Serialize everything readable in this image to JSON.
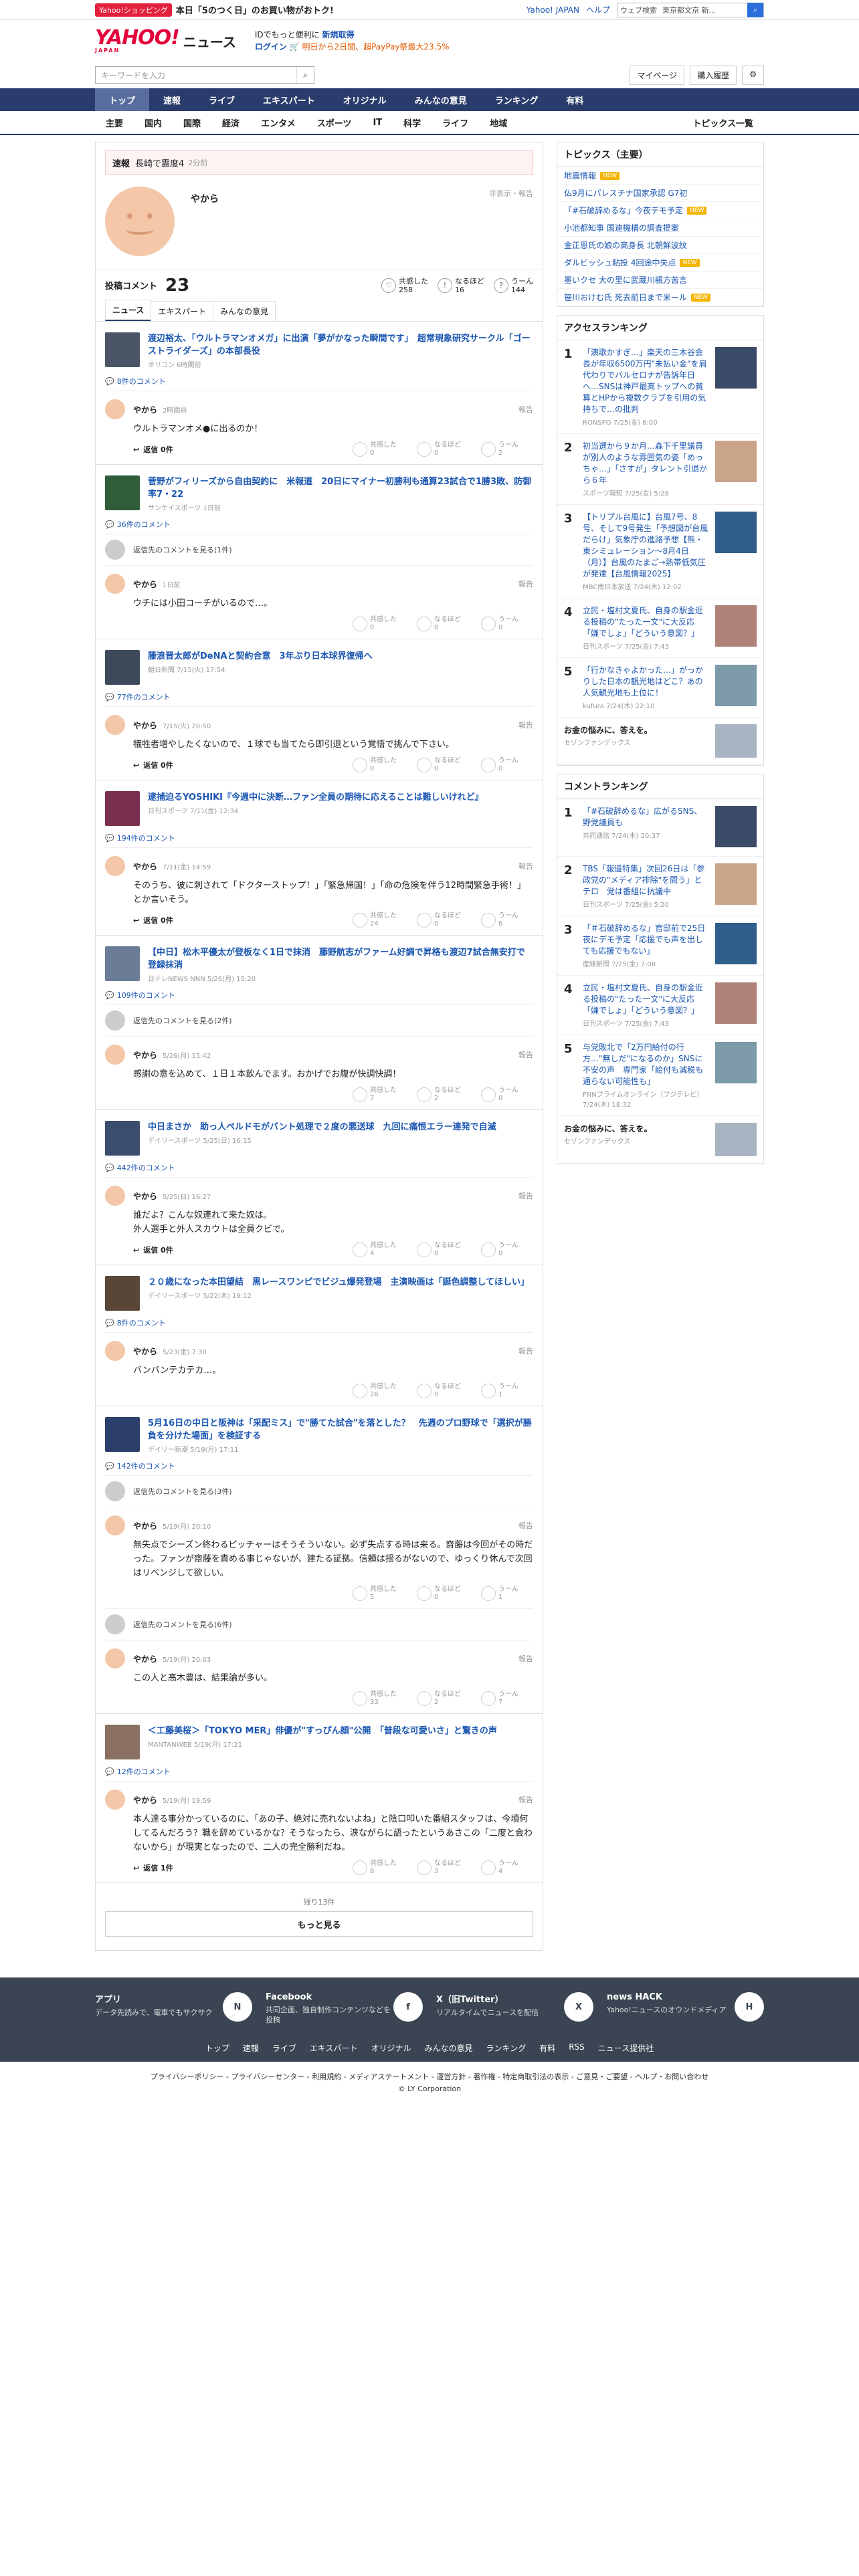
{
  "topbar": {
    "badge": "Yahoo!ショッピング",
    "promo": "本日「5のつく日」のお買い物がおトク!",
    "links": [
      "Yahoo! JAPAN",
      "ヘルプ"
    ],
    "search_placeholder": "ウェブ検索",
    "search_query": "東京都文京 新..."
  },
  "header": {
    "logo": "YAHOO!",
    "logo_sub": "JAPAN",
    "service": "ニュース",
    "line1a": "IDでもっと便利に",
    "line1b": "新規取得",
    "line2a": "ログイン",
    "line2b": "🛒 明日から2日間、超PayPay祭最大23.5%"
  },
  "search": {
    "placeholder": "キーワードを入力",
    "buttons": [
      "マイページ",
      "購入履歴"
    ]
  },
  "nav_main": [
    "トップ",
    "速報",
    "ライブ",
    "エキスパート",
    "オリジナル",
    "みんなの意見",
    "ランキング",
    "有料"
  ],
  "nav_sub": [
    "主要",
    "国内",
    "国際",
    "経済",
    "エンタメ",
    "スポーツ",
    "IT",
    "科学",
    "ライフ",
    "地域"
  ],
  "nav_sub_all": "トピックス一覧",
  "breaking": {
    "tag": "速報",
    "text": "長崎で震度4",
    "time": "2分前"
  },
  "profile": {
    "name": "やから",
    "links": "非表示・報告"
  },
  "stats": {
    "label": "投稿コメント",
    "count": "23",
    "reactions": [
      {
        "label": "共感した",
        "value": "258"
      },
      {
        "label": "なるほど",
        "value": "16"
      },
      {
        "label": "うーん",
        "value": "144"
      }
    ]
  },
  "tabs": [
    "ニュース",
    "エキスパート",
    "みんなの意見"
  ],
  "entries": [
    {
      "title": "渡辺裕太、「ウルトラマンオメガ」に出演「夢がかなった瞬間です」　超常現象研究サークル「ゴーストライダーズ」の本部長役",
      "source": "オリコン 6時間前",
      "count": "8件のコメント",
      "previews": [],
      "comments": [
        {
          "time": "2時間前",
          "text": "ウルトラマンオメ●に出るのか！",
          "reply": "返信 0件",
          "v": [
            "共感した\n0",
            "なるほど\n0",
            "うーん\n2"
          ]
        }
      ]
    },
    {
      "title": "菅野がフィリーズから自由契約に　米報道　20日にマイナー初勝利も通算23試合で1勝3敗、防御率7・22",
      "source": "サンケイスポーツ 1日前",
      "count": "36件のコメント",
      "previews": [
        "返信先のコメントを見る(1件)"
      ],
      "comments": [
        {
          "time": "1日前",
          "text": "ウチには小田コーチがいるので…。",
          "reply": "",
          "v": [
            "共感した\n0",
            "なるほど\n0",
            "うーん\n0"
          ]
        }
      ]
    },
    {
      "title": "藤浪晋太郎がDeNAと契約合意　3年ぶり日本球界復帰へ",
      "source": "朝日新聞 7/15(火) 17:54",
      "count": "77件のコメント",
      "previews": [],
      "comments": [
        {
          "time": "7/15(火) 20:50",
          "text": "犠牲者増やしたくないので、１球でも当てたら即引退という覚悟で挑んで下さい。",
          "reply": "返信 0件",
          "v": [
            "共感した\n0",
            "なるほど\n0",
            "うーん\n0"
          ]
        }
      ]
    },
    {
      "title": "逮捕迫るYOSHIKI『今週中に決断…ファン全員の期待に応えることは難しいけれど』",
      "source": "日刊スポーツ 7/11(金) 12:34",
      "count": "194件のコメント",
      "previews": [],
      "comments": [
        {
          "time": "7/11(金) 14:59",
          "text": "そのうち、彼に刺されて「ドクターストップ！」「緊急帰国！」「命の危険を伴う12時間緊急手術！」とか言いそう。",
          "reply": "返信 0件",
          "v": [
            "共感した\n24",
            "なるほど\n0",
            "うーん\n6"
          ]
        }
      ]
    },
    {
      "title": "【中日】松木平優太が登板なく1日で抹消　藤野航志がファーム好調で昇格も渡辺7試合無安打で登録抹消",
      "source": "日テレNEWS NNN 5/26(月) 15:20",
      "count": "109件のコメント",
      "previews": [
        "返信先のコメントを見る(2件)"
      ],
      "comments": [
        {
          "time": "5/26(月) 15:42",
          "text": "感謝の意を込めて、１日１本飲んでます。おかげでお腹が快調快調！",
          "reply": "",
          "v": [
            "共感した\n7",
            "なるほど\n2",
            "うーん\n0"
          ]
        }
      ]
    },
    {
      "title": "中日まさか　助っ人ペルドモがバント処理で２度の悪送球　九回に痛恨エラー連発で自滅",
      "source": "デイリースポーツ 5/25(日) 16:15",
      "count": "442件のコメント",
      "previews": [],
      "comments": [
        {
          "time": "5/25(日) 16:27",
          "text": "誰だよ？こんな奴連れて来た奴は。\n外人選手と外人スカウトは全員クビで。",
          "reply": "返信 0件",
          "v": [
            "共感した\n4",
            "なるほど\n0",
            "うーん\n0"
          ]
        }
      ]
    },
    {
      "title": "２０歳になった本田望結　黒レースワンピでビジュ爆発登場　主演映画は「誕色調整してほしい」",
      "source": "デイリースポーツ 5/22(木) 19:12",
      "count": "8件のコメント",
      "previews": [],
      "comments": [
        {
          "time": "5/23(金) 7:30",
          "text": "バンバンテカテカ…。",
          "reply": "",
          "v": [
            "共感した\n26",
            "なるほど\n0",
            "うーん\n1"
          ]
        }
      ]
    },
    {
      "title": "5月16日の中日と阪神は「采配ミス」で\"勝てた試合\"を落とした？　先週のプロ野球で「選択が勝負を分けた場面」を検証する",
      "source": "デイリー新潮 5/19(月) 17:11",
      "count": "142件のコメント",
      "previews": [
        "返信先のコメントを見る(3件)"
      ],
      "comments": [
        {
          "time": "5/19(月) 20:10",
          "text": "無失点でシーズン終わるピッチャーはそうそういない。必ず失点する時は来る。齋藤は今回がその時だった。ファンが齋藤を責める事じゃないが、建たる証拠。信頼は揺るがないので、ゆっくり休んで次回はリベンジして欲しい。",
          "reply": "",
          "v": [
            "共感した\n5",
            "なるほど\n0",
            "うーん\n1"
          ]
        },
        {
          "pre": "返信先のコメントを見る(6件)",
          "time": "5/19(月) 20:03",
          "text": "この人と髙木豊は、結果論が多い。",
          "reply": "",
          "v": [
            "共感した\n33",
            "なるほど\n2",
            "うーん\n7"
          ]
        }
      ]
    },
    {
      "title": "＜工藤美桜＞「TOKYO MER」俳優が\"すっぴん顔\"公開　「普段な可愛いさ」と驚きの声",
      "source": "MANTANWEB 5/19(月) 17:21",
      "count": "12件のコメント",
      "previews": [],
      "comments": [
        {
          "time": "5/19(月) 19:59",
          "text": "本人達る事分かっているのに、「あの子、絶対に売れないよね」と陰口叩いた番組スタッフは、今頃何してるんだろう？職を辞めているかな？そうなったら、涙ながらに語ったというあさこの「二度と会わないから」が現実となったので、二人の完全勝利だね。",
          "reply": "返信 1件",
          "v": [
            "共感した\n8",
            "なるほど\n3",
            "うーん\n4"
          ]
        }
      ]
    }
  ],
  "remain": "残り13件",
  "more": "もっと見る",
  "topics": {
    "heading": "トピックス（主要）",
    "items": [
      {
        "t": "地震情報",
        "n": "NEW"
      },
      {
        "t": "仏9月にパレスチナ国家承認 G7初",
        "n": ""
      },
      {
        "t": "「#石破辞めるな」今夜デモ予定",
        "n": "NEW"
      },
      {
        "t": "小池都知事 国連機構の調査提案",
        "n": ""
      },
      {
        "t": "金正恩氏の娘の高身長 北朝鮮波紋",
        "n": ""
      },
      {
        "t": "ダルビッシュ粘投 4回途中失点",
        "n": "NEW"
      },
      {
        "t": "墨いクセ 大の里に武蔵川親方苦言",
        "n": ""
      },
      {
        "t": "笹川おけむ氏 死去前日まで米ール",
        "n": "NEW"
      }
    ]
  },
  "access": {
    "heading": "アクセスランキング",
    "items": [
      {
        "t": "「演歌かすぎ…」楽天の三木谷会長が年収6500万円\"未払い金\"を肩代わりでバルセロナが告訴年日へ…SNSは神戸最高トップへの貧算とHPから複数クラブを引用の気持ちで…の批判",
        "s": "RONSPO 7/25(金) 6:00"
      },
      {
        "t": "初当選から９か月…森下千里議員が別人のような雰囲気の姿「めっちゃ…」「さすが」タレント引退から６年",
        "s": "スポーツ報知 7/25(金) 5:28"
      },
      {
        "t": "【トリプル台風に】台風7号、8号、そして9号発生「予想図が台風だらけ」気象庁の進路予想【熊・東シミュレーション〜8月4日（月）】台風のたまご→熱帯低気圧が発達【台風情報2025】",
        "s": "MBC南日本放送 7/24(木) 12:02"
      },
      {
        "t": "立民・塩村文夏氏、自身の駅金近る投稿の\"たった一文\"に大反応「嫌でしょ」「どういう意図？」",
        "s": "日刊スポーツ 7/25(金) 7:43"
      },
      {
        "t": "「行かなきゃよかった…」がっかりした日本の観光地はどこ？あの人気観光地も上位に！",
        "s": "kufura 7/24(木) 22:10"
      }
    ]
  },
  "pr1": {
    "t": "お金の悩みに、答えを。",
    "s": "セゾンファンデックス"
  },
  "commentrank": {
    "heading": "コメントランキング",
    "items": [
      {
        "t": "「#石破辞めるな」広がるSNS、野党議員も",
        "s": "共同通信 7/24(木) 20:37"
      },
      {
        "t": "TBS「報道特集」次回26日は「参政党の\"メディア排除\"を問う」とテロ　党は番組に抗議中",
        "s": "日刊スポーツ 7/25(金) 5:20"
      },
      {
        "t": "「＃石破辞めるな」官邸前で25日夜にデモ予定「応援でも声を出しても応援でもない」",
        "s": "産経新聞 7/25(金) 7:08"
      },
      {
        "t": "立民・塩村文夏氏、自身の駅金近る投稿の\"たった一文\"に大反応「嫌でしょ」「どういう意図？」",
        "s": "日刊スポーツ 7/25(金) 7:43"
      },
      {
        "t": "与党敗北で「2万円給付の行方…\"無しだ\"になるのか」SNSに不安の声　専門家「給付も減税も通らない可能性も」",
        "s": "FNNプライムオンライン（フジテレビ） 7/24(木) 18:32"
      }
    ]
  },
  "pr2": {
    "t": "お金の悩みに、答えを。",
    "s": "セゾンファンデックス"
  },
  "footer": {
    "cols": [
      {
        "h": "アプリ",
        "d": "データ先読みで、電車でもサクサク",
        "i": "N"
      },
      {
        "h": "Facebook",
        "d": "共同企画、独自制作コンテンツなどを投稿",
        "i": "f"
      },
      {
        "h": "X（旧Twitter）",
        "d": "リアルタイムでニュースを配信",
        "i": "X"
      },
      {
        "h": "news HACK",
        "d": "Yahoo!ニュースのオウンドメディア",
        "i": "H"
      }
    ],
    "nav": [
      "トップ",
      "速報",
      "ライブ",
      "エキスパート",
      "オリジナル",
      "みんなの意見",
      "ランキング",
      "有料",
      "RSS",
      "ニュース提供社"
    ],
    "legal": "プライバシーポリシー - プライバシーセンター - 利用規約 - メディアステートメント - 運営方針 - 著作権 - 特定商取引法の表示 - ご意見・ご要望 - ヘルプ・お問い合わせ",
    "copy": "© LY Corporation"
  },
  "colors": {
    "accent": "#2a3c6b",
    "link": "#1a56b2",
    "brand": "#e3003a"
  }
}
